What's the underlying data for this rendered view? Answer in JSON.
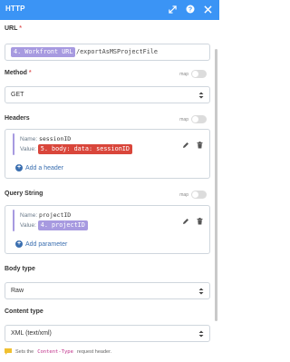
{
  "header": {
    "title": "HTTP",
    "icons": [
      "expand-icon",
      "help-icon",
      "close-icon"
    ]
  },
  "url": {
    "label": "URL",
    "required_mark": "*",
    "tokens": [
      {
        "text": "4. Workfront URL",
        "color": "#a79ae0"
      }
    ],
    "suffix": "/exportAsMSProjectFile"
  },
  "method": {
    "label": "Method",
    "required_mark": "*",
    "map_label": "map",
    "value": "GET"
  },
  "headers": {
    "label": "Headers",
    "map_label": "map",
    "items": [
      {
        "name_key": "Name:",
        "name": "sessionID",
        "value_key": "Value:",
        "value": "5. body: data: sessionID",
        "value_color": "#d9463b"
      }
    ],
    "add_label": "Add a header"
  },
  "query": {
    "label": "Query String",
    "map_label": "map",
    "items": [
      {
        "name_key": "Name:",
        "name": "projectID",
        "value_key": "Value:",
        "value": "4. projectID",
        "value_color": "#a79ae0"
      }
    ],
    "add_label": "Add parameter"
  },
  "body_type": {
    "label": "Body type",
    "value": "Raw"
  },
  "content_type": {
    "label": "Content type",
    "value": "XML (text/xml)"
  },
  "hint": {
    "prefix": "Sets the",
    "code": "Content-Type",
    "suffix": "request header."
  }
}
